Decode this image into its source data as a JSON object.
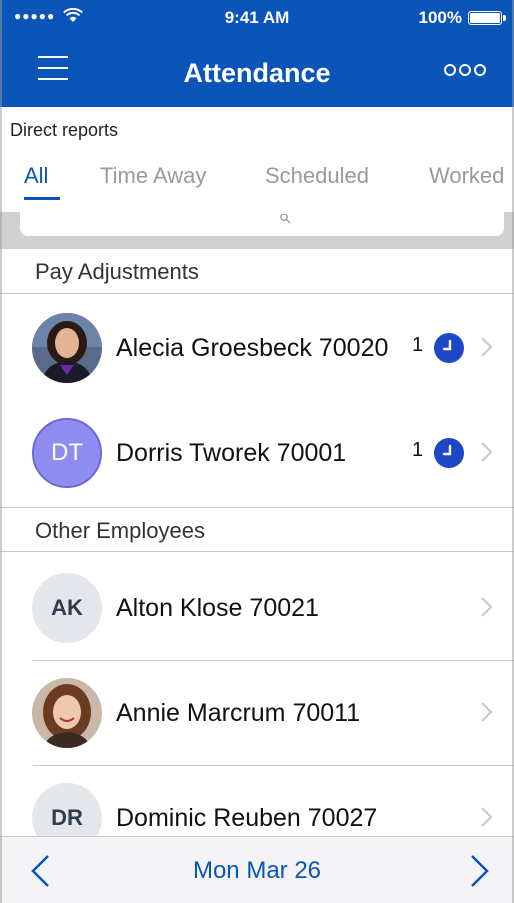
{
  "status_bar": {
    "time": "9:41 AM",
    "battery_text": "100%",
    "battery_level": 1.0,
    "signal_dots": "●●●●●"
  },
  "nav": {
    "title": "Attendance",
    "menu_icon": "hamburger-menu-icon",
    "more_icon": "more-options-icon"
  },
  "subheader": {
    "label": "Direct reports",
    "tabs": [
      {
        "label": "All",
        "active": true
      },
      {
        "label": "Time Away",
        "active": false
      },
      {
        "label": "Scheduled",
        "active": false
      },
      {
        "label": "Worked",
        "active": false
      }
    ]
  },
  "sections": [
    {
      "title": "Pay Adjustments",
      "rows": [
        {
          "name": "Alecia Groesbeck 70020",
          "count": "1",
          "avatar": "photo",
          "badge_icon": "clock-icon"
        },
        {
          "name": "Dorris Tworek 70001",
          "count": "1",
          "avatar_initials": "DT",
          "badge_icon": "clock-icon"
        }
      ]
    },
    {
      "title": "Other Employees",
      "rows": [
        {
          "name": "Alton Klose 70021",
          "avatar_initials": "AK"
        },
        {
          "name": "Annie Marcrum 70011",
          "avatar": "photo"
        },
        {
          "name": "Dominic Reuben 70027",
          "avatar_initials": "DR"
        }
      ]
    }
  ],
  "bottom_bar": {
    "date": "Mon Mar 26",
    "prev_icon": "chevron-left-icon",
    "next_icon": "chevron-right-icon"
  },
  "colors": {
    "brand_blue": "#0b54b8",
    "clock_blue": "#1d47c6",
    "avatar_purple": "#8f8df0"
  }
}
